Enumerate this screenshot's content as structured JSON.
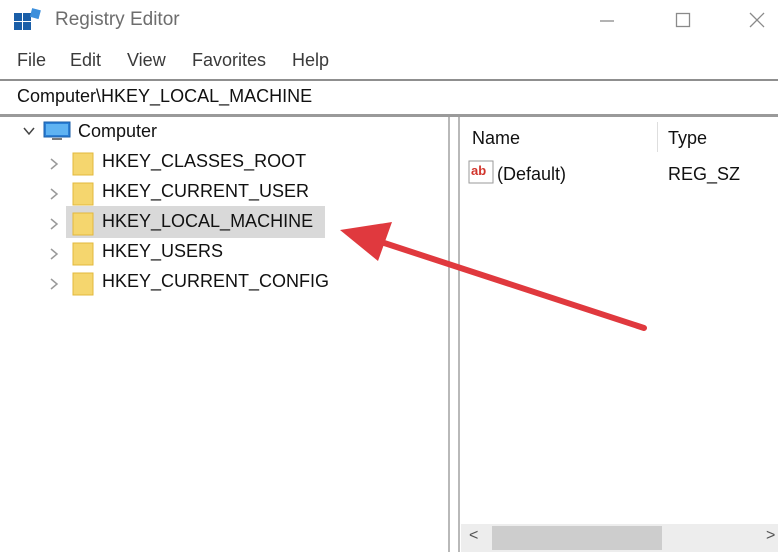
{
  "window": {
    "title": "Registry Editor",
    "controls": {
      "minimize": "minimize-icon",
      "maximize": "maximize-icon",
      "close": "close-icon"
    }
  },
  "menu": {
    "items": [
      "File",
      "Edit",
      "View",
      "Favorites",
      "Help"
    ]
  },
  "address": {
    "path": "Computer\\HKEY_LOCAL_MACHINE"
  },
  "tree": {
    "root": "Computer",
    "children": [
      "HKEY_CLASSES_ROOT",
      "HKEY_CURRENT_USER",
      "HKEY_LOCAL_MACHINE",
      "HKEY_USERS",
      "HKEY_CURRENT_CONFIG"
    ],
    "selected": "HKEY_LOCAL_MACHINE"
  },
  "list": {
    "columns": [
      "Name",
      "Type"
    ],
    "rows": [
      {
        "icon": "string-value-icon",
        "icon_text": "ab",
        "name": "(Default)",
        "type": "REG_SZ"
      }
    ]
  },
  "scrollbar": {
    "left_arrow": "<",
    "right_arrow": ">"
  },
  "colors": {
    "folder": "#f5d66e",
    "folder_edge": "#e2b83c",
    "selection": "#d9d9d9",
    "annotation_arrow": "#e0393e",
    "app_icon_blue": "#1a5ea8"
  }
}
